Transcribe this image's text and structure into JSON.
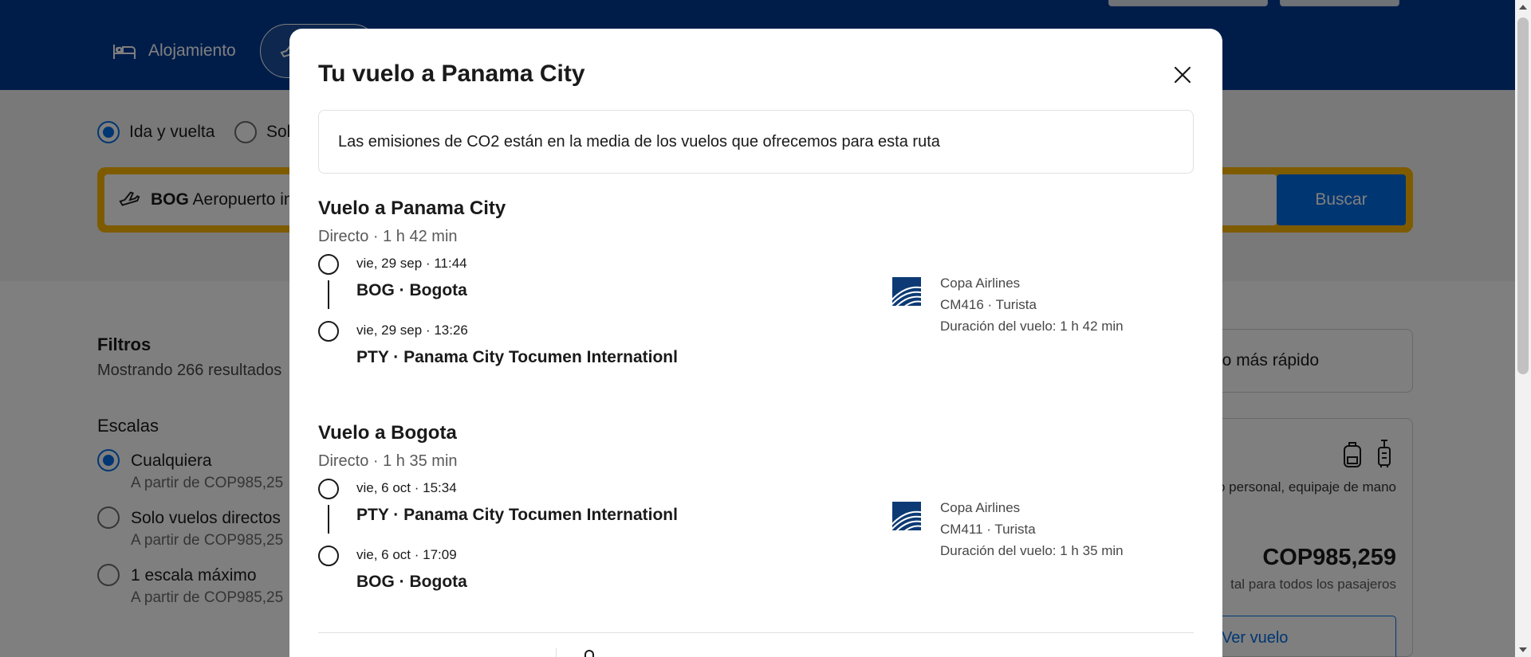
{
  "background": {
    "nav": {
      "lodging_label": "Alojamiento"
    },
    "trip_type": {
      "round_trip": "Ida y vuelta",
      "one_way_partial": "Sol"
    },
    "search": {
      "origin_code": "BOG",
      "origin_name_partial": "Aeropuerto in",
      "button_label": "Buscar"
    },
    "filters": {
      "title": "Filtros",
      "showing_partial": "Mostrando 266 resultados",
      "stops_title": "Escalas",
      "options": [
        {
          "label": "Cualquiera",
          "price": "A partir de COP985,25",
          "selected": true
        },
        {
          "label": "Solo vuelos directos",
          "price": "A partir de COP985,25",
          "selected": false
        },
        {
          "label": "1 escala máximo",
          "price": "A partir de COP985,25",
          "selected": false
        }
      ]
    },
    "sort": {
      "fastest_partial": "Lo más rápido"
    },
    "result": {
      "baggage_text_partial": "sorio personal, equipaje de mano",
      "price": "COP985,259",
      "price_note_partial": "tal para todos los pasajeros",
      "view_button": "Ver vuelo"
    }
  },
  "modal": {
    "title": "Tu vuelo a Panama City",
    "co2_notice": "Las emisiones de CO2 están en la media de los vuelos que ofrecemos para esta ruta",
    "legs": [
      {
        "title": "Vuelo a Panama City",
        "summary": "Directo · 1 h 42 min",
        "departure": {
          "time": "vie, 29 sep · 11:44",
          "place": "BOG · Bogota"
        },
        "arrival": {
          "time": "vie, 29 sep · 13:26",
          "place": "PTY · Panama City Tocumen Internationl"
        },
        "airline": {
          "name": "Copa Airlines",
          "flight": "CM416 · Turista",
          "duration": "Duración del vuelo: 1 h 42 min"
        }
      },
      {
        "title": "Vuelo a Bogota",
        "summary": "Directo · 1 h 35 min",
        "departure": {
          "time": "vie, 6 oct · 15:34",
          "place": "PTY · Panama City Tocumen Internationl"
        },
        "arrival": {
          "time": "vie, 6 oct · 17:09",
          "place": "BOG · Bogota"
        },
        "airline": {
          "name": "Copa Airlines",
          "flight": "CM411 · Turista",
          "duration": "Duración del vuelo: 1 h 35 min"
        }
      }
    ]
  },
  "colors": {
    "brand_blue": "#003b95",
    "action_blue": "#006ce4",
    "search_border": "#ffb700",
    "airline_logo": "#0d3a74"
  },
  "icons": [
    "bed-icon",
    "plane-icon",
    "close-icon",
    "copa-airlines-logo",
    "backpack-icon",
    "carry-on-icon"
  ]
}
